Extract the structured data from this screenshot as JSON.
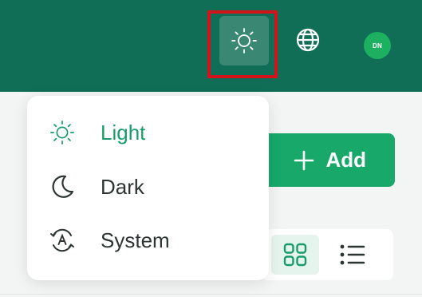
{
  "header": {
    "avatar_initials": "DN",
    "background_color": "#0f6e55",
    "icons": [
      "sun-icon",
      "globe-icon"
    ]
  },
  "theme_menu": {
    "selected": "Light",
    "items": [
      {
        "label": "Light",
        "icon": "sun-icon",
        "active": true
      },
      {
        "label": "Dark",
        "icon": "moon-icon",
        "active": false
      },
      {
        "label": "System",
        "icon": "auto-theme-icon",
        "active": false
      }
    ],
    "accent_color": "#1a9c6a"
  },
  "toolbar": {
    "add_label": "Add",
    "add_color": "#17a86a",
    "view_options": [
      "grid-view-icon",
      "list-view-icon"
    ],
    "active_view": "grid"
  },
  "highlight_color": "#d3141c"
}
